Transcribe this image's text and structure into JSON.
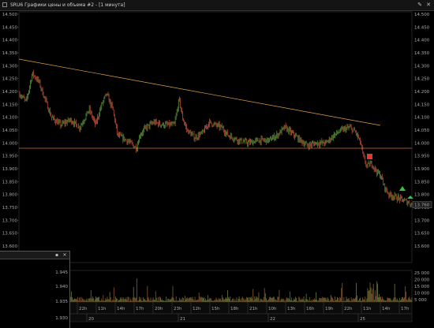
{
  "window": {
    "title": "SRU6 Графики цены и объема #2 - [1 минута]",
    "pin_glyph": "✎",
    "close_glyph": "✕"
  },
  "price_axis": {
    "labels": [
      "14.500",
      "14.450",
      "14.400",
      "14.350",
      "14.300",
      "14.250",
      "14.200",
      "14.150",
      "14.100",
      "14.050",
      "14.000",
      "13.950",
      "13.900",
      "13.850",
      "13.800",
      "13.750",
      "13.700",
      "13.650",
      "13.600"
    ],
    "last_price": "13.760"
  },
  "volume_axis": {
    "labels": [
      "25 000",
      "20 000",
      "15 000",
      "10 000",
      "5 000"
    ]
  },
  "time_axis": {
    "hours": [
      "22h",
      "11h",
      "14h",
      "17h",
      "20h",
      "23h",
      "12h",
      "15h",
      "18h",
      "21h",
      "10h",
      "13h",
      "16h",
      "19h",
      "22h",
      "11h",
      "14h",
      "17h"
    ],
    "days": [
      "20",
      "21",
      "22",
      "25"
    ]
  },
  "sub_window": {
    "labels": [
      "1.945",
      "1.940",
      "1.935",
      "1.930"
    ]
  },
  "colors": {
    "trend_line": "#e0a040",
    "support_line": "#c8733a",
    "candle_up": "#5a8c3a",
    "candle_down": "#b84a30",
    "volume": "#8a5a2a",
    "signal_buy": "#39c23a",
    "signal_sell": "#e03a2a"
  },
  "icons": [
    "window-icon",
    "pin-icon",
    "close-icon"
  ]
}
